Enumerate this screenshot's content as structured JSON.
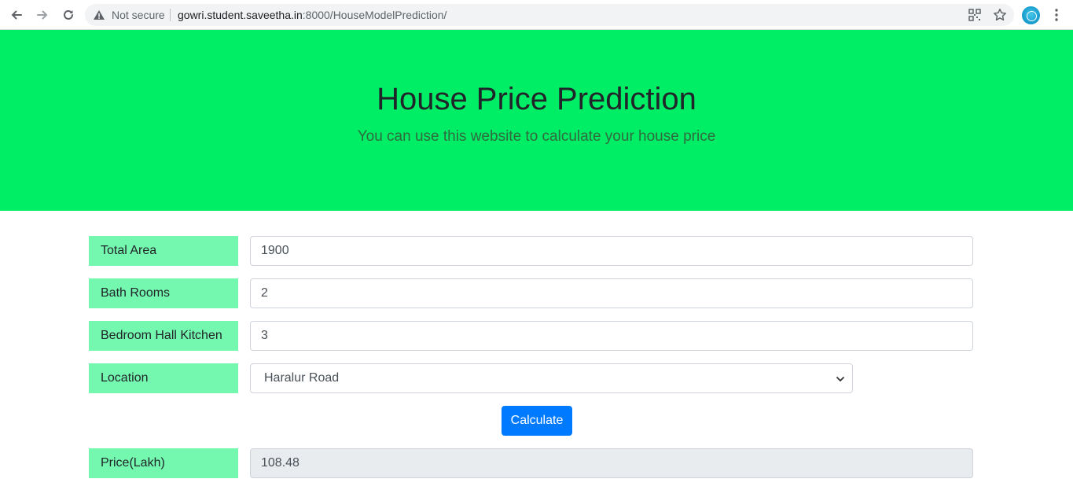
{
  "browser": {
    "security_text": "Not secure",
    "url_host": "gowri.student.saveetha.in",
    "url_path": ":8000/HouseModelPrediction/"
  },
  "hero": {
    "title": "House Price Prediction",
    "subtitle": "You can use this website to calculate your house price"
  },
  "form": {
    "total_area": {
      "label": "Total Area",
      "value": "1900"
    },
    "bath_rooms": {
      "label": "Bath Rooms",
      "value": "2"
    },
    "bhk": {
      "label": "Bedroom Hall Kitchen",
      "value": "3"
    },
    "location": {
      "label": "Location",
      "selected": "Haralur Road"
    },
    "calculate_label": "Calculate",
    "price": {
      "label": "Price(Lakh)",
      "value": "108.48"
    }
  },
  "colors": {
    "hero_bg": "#00ee66",
    "label_bg": "#74f8b0",
    "button_bg": "#007bff"
  }
}
